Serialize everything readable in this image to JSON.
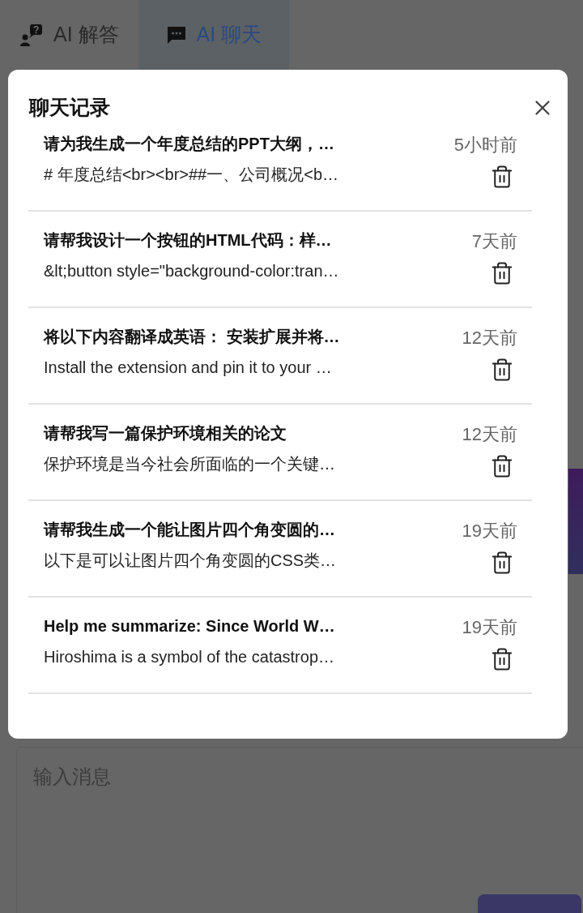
{
  "tabs": [
    {
      "label": "AI 解答",
      "kind": "answer",
      "selected": false
    },
    {
      "label": "AI 聊天",
      "kind": "chat",
      "selected": true
    }
  ],
  "dialog": {
    "title": "聊天记录",
    "items": [
      {
        "title": "请为我生成一个年度总结的PPT大纲，…",
        "preview": "# 年度总结<br><br>##一、公司概况<b…",
        "time": "5小时前"
      },
      {
        "title": "请帮我设计一个按钮的HTML代码：样…",
        "preview": "&lt;button style=\"background-color:tran…",
        "time": "7天前"
      },
      {
        "title": "将以下内容翻译成英语： 安装扩展并将…",
        "preview": "Install the extension and pin it to your …",
        "time": "12天前"
      },
      {
        "title": "请帮我写一篇保护环境相关的论文",
        "preview": "保护环境是当今社会所面临的一个关键…",
        "time": "12天前"
      },
      {
        "title": "请帮我生成一个能让图片四个角变圆的…",
        "preview": "以下是可以让图片四个角变圆的CSS类…",
        "time": "19天前"
      },
      {
        "title": "Help me summarize: Since World W…",
        "preview": "Hiroshima is a symbol of the catastrop…",
        "time": "19天前"
      }
    ]
  },
  "composer": {
    "placeholder": "输入消息"
  }
}
